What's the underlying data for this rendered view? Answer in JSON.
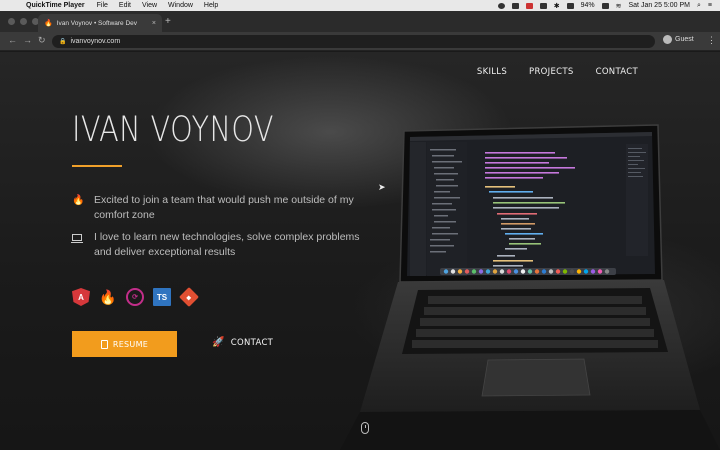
{
  "menubar": {
    "app_name": "QuickTime Player",
    "items": [
      "File",
      "Edit",
      "View",
      "Window",
      "Help"
    ],
    "battery": "94%",
    "datetime": "Sat Jan 25  5:00 PM"
  },
  "browser": {
    "tab_title": "Ivan Voynov • Software Dev",
    "url": "ivanvoynov.com",
    "profile": "Guest"
  },
  "nav": {
    "skills": "SKILLS",
    "projects": "PROJECTS",
    "contact": "CONTACT"
  },
  "hero": {
    "name": "IVAN VOYNOV",
    "bullet1": "Excited to join a team that would push me outside of my comfort zone",
    "bullet2": "I love to learn new technologies, solve complex problems and deliver exceptional results"
  },
  "tech_icons": [
    "angular-icon",
    "firebase-icon",
    "ngrx-icon",
    "typescript-icon",
    "git-icon"
  ],
  "tech_glyphs": {
    "angular": "A",
    "typescript": "TS",
    "git": "◆"
  },
  "actions": {
    "resume": "RESUME",
    "contact": "CONTACT"
  },
  "colors": {
    "accent": "#f29c1d",
    "background": "#1b1b1b"
  }
}
